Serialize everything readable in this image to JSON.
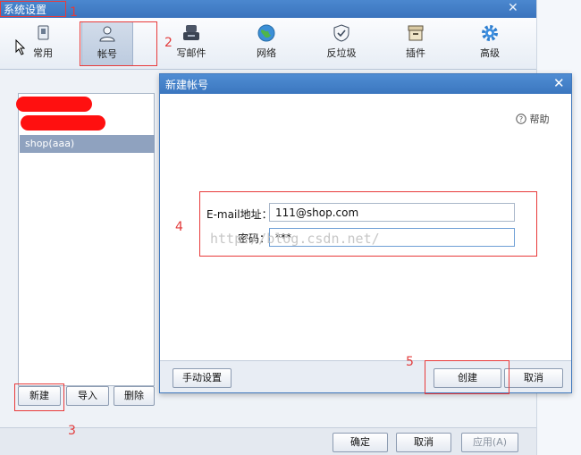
{
  "window": {
    "title": "系统设置",
    "close_glyph": "✕"
  },
  "toolbar": {
    "items": [
      {
        "label": "常用",
        "icon": "device-icon"
      },
      {
        "label": "帐号",
        "icon": "user-icon",
        "selected": true
      },
      {
        "label": "写邮件",
        "icon": "compose-icon"
      },
      {
        "label": "网络",
        "icon": "globe-icon"
      },
      {
        "label": "反垃圾",
        "icon": "shield-icon"
      },
      {
        "label": "插件",
        "icon": "plugin-box-icon"
      },
      {
        "label": "高级",
        "icon": "gear-icon"
      }
    ]
  },
  "accounts": {
    "items": [
      "shop(aaa)"
    ],
    "new_label": "新建",
    "import_label": "导入",
    "delete_label": "删除"
  },
  "footer": {
    "ok_label": "确定",
    "cancel_label": "取消",
    "apply_label": "应用(A)"
  },
  "dialog": {
    "title": "新建帐号",
    "close_glyph": "✕",
    "help_label": "帮助",
    "email_label": "E-mail地址：",
    "email_value": "111@shop.com",
    "password_label": "密码：",
    "password_value": "***",
    "watermark": "http://blog.csdn.net/",
    "manual_label": "手动设置",
    "create_label": "创建",
    "cancel_label": "取消"
  },
  "annotations": [
    "1",
    "2",
    "3",
    "4",
    "5"
  ],
  "colors": {
    "accent": "#3b76bf",
    "annotation": "#e23b3b"
  }
}
